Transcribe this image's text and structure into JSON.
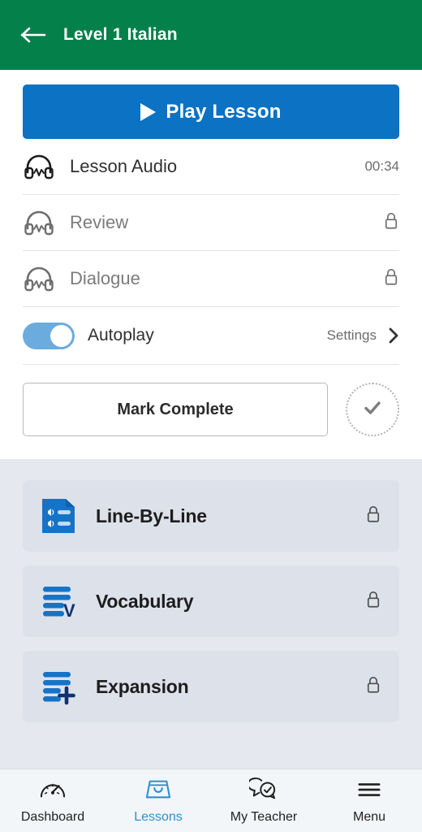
{
  "header": {
    "title": "Level 1 Italian",
    "back_icon": "arrow-left-icon",
    "background_color": "#04804b"
  },
  "main": {
    "play_button": {
      "label": "Play Lesson",
      "icon": "play-triangle-icon",
      "color": "#0b72c4"
    },
    "audio_rows": [
      {
        "label": "Lesson Audio",
        "icon": "headphones-icon",
        "time": "00:34",
        "locked": false
      },
      {
        "label": "Review",
        "icon": "headphones-icon",
        "time": "",
        "locked": true
      },
      {
        "label": "Dialogue",
        "icon": "headphones-icon",
        "time": "",
        "locked": true
      }
    ],
    "autoplay": {
      "label": "Autoplay",
      "enabled": true,
      "settings_label": "Settings",
      "chevron_icon": "chevron-right-icon",
      "toggle_color": "#6cabdd"
    },
    "mark_complete": {
      "label": "Mark Complete",
      "check_icon": "check-icon"
    }
  },
  "sections": [
    {
      "label": "Line-By-Line",
      "icon": "document-audio-lines-icon",
      "locked": true
    },
    {
      "label": "Vocabulary",
      "icon": "lines-v-icon",
      "locked": true
    },
    {
      "label": "Expansion",
      "icon": "lines-plus-icon",
      "locked": true
    }
  ],
  "bottom_nav": {
    "active": "Lessons",
    "accent_color": "#2d8fd0",
    "items": [
      {
        "label": "Dashboard",
        "icon": "gauge-icon"
      },
      {
        "label": "Lessons",
        "icon": "inbox-icon"
      },
      {
        "label": "My Teacher",
        "icon": "chat-check-icon"
      },
      {
        "label": "Menu",
        "icon": "hamburger-icon"
      }
    ]
  }
}
